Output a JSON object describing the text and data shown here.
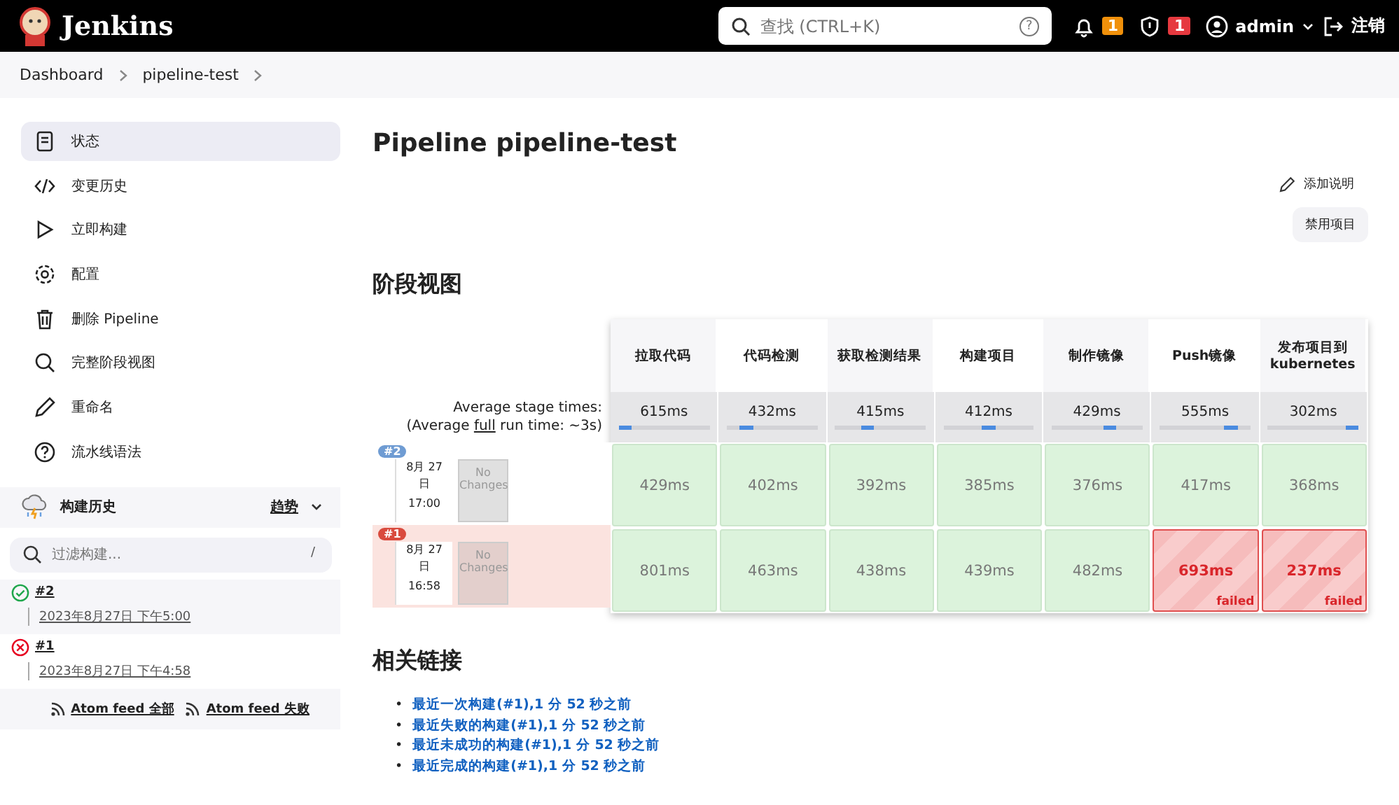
{
  "header": {
    "brand": "Jenkins",
    "search": {
      "placeholder": "查找 (CTRL+K)",
      "help": "?"
    },
    "notifications": "1",
    "security": "1",
    "user": "admin",
    "logout": "注销"
  },
  "breadcrumbs": [
    "Dashboard",
    "pipeline-test"
  ],
  "sidebar": {
    "items": [
      {
        "label": "状态",
        "selected": true
      },
      {
        "label": "变更历史",
        "selected": false
      },
      {
        "label": "立即构建",
        "selected": false
      },
      {
        "label": "配置",
        "selected": false
      },
      {
        "label": "删除 Pipeline",
        "selected": false
      },
      {
        "label": "完整阶段视图",
        "selected": false
      },
      {
        "label": "重命名",
        "selected": false
      },
      {
        "label": "流水线语法",
        "selected": false
      }
    ]
  },
  "build_history": {
    "title": "构建历史",
    "trend": "趋势",
    "filter": {
      "placeholder": "过滤构建...",
      "shortcut": "/"
    },
    "builds": [
      {
        "number": "#2",
        "date": "2023年8月27日 下午5:00",
        "failed": false
      },
      {
        "number": "#1",
        "date": "2023年8月27日 下午4:58",
        "failed": true
      }
    ],
    "feeds": [
      "Atom feed 全部",
      "Atom feed 失败"
    ]
  },
  "main": {
    "title": "Pipeline pipeline-test",
    "add_description": "添加说明",
    "disable": "禁用项目",
    "stage_view_title": "阶段视图",
    "stage_view": {
      "avg_label": "Average stage times:",
      "avg_full_prefix": "(Average ",
      "avg_full_link": "full",
      "avg_full_suffix": " run time: ~3s)",
      "stages": [
        {
          "name": "拉取代码",
          "avg": "615ms"
        },
        {
          "name": "代码检测",
          "avg": "432ms"
        },
        {
          "name": "获取检测结果",
          "avg": "415ms"
        },
        {
          "name": "构建项目",
          "avg": "412ms"
        },
        {
          "name": "制作镜像",
          "avg": "429ms"
        },
        {
          "name": "Push镜像",
          "avg": "555ms"
        },
        {
          "name": "发布项目到 kubernetes",
          "avg": "302ms"
        }
      ],
      "runs": [
        {
          "number": "#2",
          "failed": false,
          "month_day": "8月 27",
          "day_suffix": "日",
          "time": "17:00",
          "changes": "No Changes",
          "cells": [
            {
              "time": "429ms",
              "failed": false
            },
            {
              "time": "402ms",
              "failed": false
            },
            {
              "time": "392ms",
              "failed": false
            },
            {
              "time": "385ms",
              "failed": false
            },
            {
              "time": "376ms",
              "failed": false
            },
            {
              "time": "417ms",
              "failed": false
            },
            {
              "time": "368ms",
              "failed": false
            }
          ]
        },
        {
          "number": "#1",
          "failed": true,
          "month_day": "8月 27",
          "day_suffix": "日",
          "time": "16:58",
          "changes": "No Changes",
          "cells": [
            {
              "time": "801ms",
              "failed": false
            },
            {
              "time": "463ms",
              "failed": false
            },
            {
              "time": "438ms",
              "failed": false
            },
            {
              "time": "439ms",
              "failed": false
            },
            {
              "time": "482ms",
              "failed": false
            },
            {
              "time": "693ms",
              "failed": true,
              "tag": "failed"
            },
            {
              "time": "237ms",
              "failed": true,
              "tag": "failed"
            }
          ]
        }
      ]
    },
    "related_title": "相关链接",
    "related_links": [
      {
        "bullet": "•",
        "text": "最近一次构建(#1),1 分 52 秒之前"
      },
      {
        "bullet": "•",
        "text": "最近失败的构建(#1),1 分 52 秒之前"
      },
      {
        "bullet": "•",
        "text": "最近未成功的构建(#1),1 分 52 秒之前"
      },
      {
        "bullet": "•",
        "text": "最近完成的构建(#1),1 分 52 秒之前"
      }
    ]
  }
}
